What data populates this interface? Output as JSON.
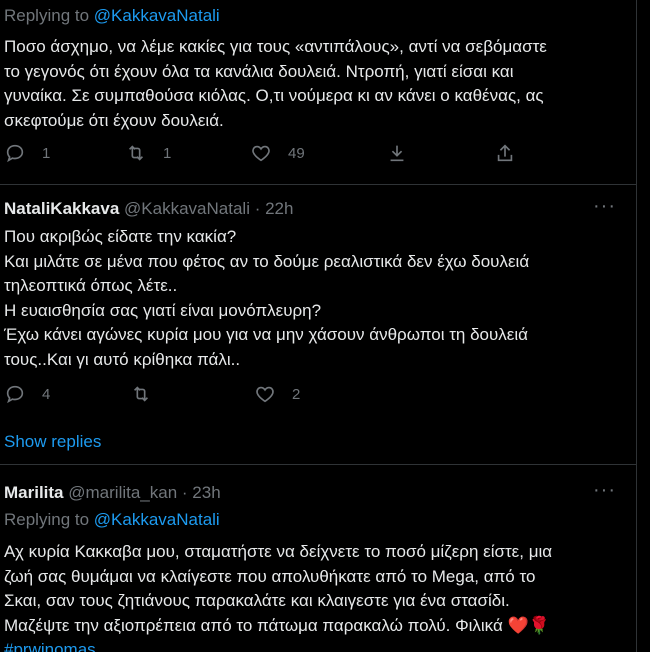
{
  "tweet1": {
    "reply_prefix": "Replying to ",
    "reply_handle": "@KakkavaNatali",
    "text": "Ποσο άσχημο, να λέμε κακίες για τους «αντιπάλους», αντί να σεβόμαστε\nτο γεγονός ότι έχουν όλα τα κανάλια δουλειά. Ντροπή, γιατί είσαι και\nγυναίκα. Σε συμπαθούσα κιόλας. Ο,τι νούμερα κι αν κάνει ο καθένας, ας\nσκεφτούμε ότι έχουν δουλειά.",
    "replies": "1",
    "retweets": "1",
    "likes": "49"
  },
  "tweet2": {
    "name": "NataliKakkava",
    "handle": "@KakkavaNatali",
    "separator": " · ",
    "time": "22h",
    "more": "···",
    "text": "Που ακριβώς είδατε την κακία?\nΚαι μιλάτε σε μένα που φέτος αν το δούμε ρεαλιστικά δεν έχω δουλειά\nτηλεοπτικά  όπως λέτε..\nΗ ευαισθησία σας γιατί είναι μονόπλευρη?\nΈχω κάνει αγώνες κυρία μου για να μην χάσουν άνθρωποι τη δουλειά\nτους..Και γι αυτό κρίθηκα πάλι..",
    "replies": "4",
    "retweets": "",
    "likes": "2"
  },
  "show_replies": "Show replies",
  "tweet3": {
    "name": "Marilita",
    "handle": "@marilita_kan",
    "separator": " · ",
    "time": "23h",
    "more": "···",
    "reply_prefix": "Replying to ",
    "reply_handle": "@KakkavaNatali",
    "text": "Αχ κυρία Κακκαβα μου, σταματήστε να δείχνετε το ποσό μίζερη είστε, μια\nζωή σας θυμάμαι να κλαίγεστε που απολυθήκατε από το Mega, από το\nΣκαι, σαν τους ζητιάνους παρακαλάτε και κλαιγεστε για ένα στασίδι.\nΜαζέψτε την αξιοπρέπεια από το πάτωμα παρακαλώ πολύ. Φιλικά",
    "hashtag": "#prwinomas",
    "heart_emoji": "❤️",
    "rose_emoji": "🌹"
  },
  "icons": {
    "reply": "reply-icon",
    "retweet": "retweet-icon",
    "like": "like-icon",
    "share": "share-icon",
    "download": "download-icon"
  },
  "colors": {
    "background": "#000000",
    "text": "#e7e9ea",
    "muted": "#71767b",
    "link": "#1d9bf0",
    "border": "#2f3336"
  }
}
